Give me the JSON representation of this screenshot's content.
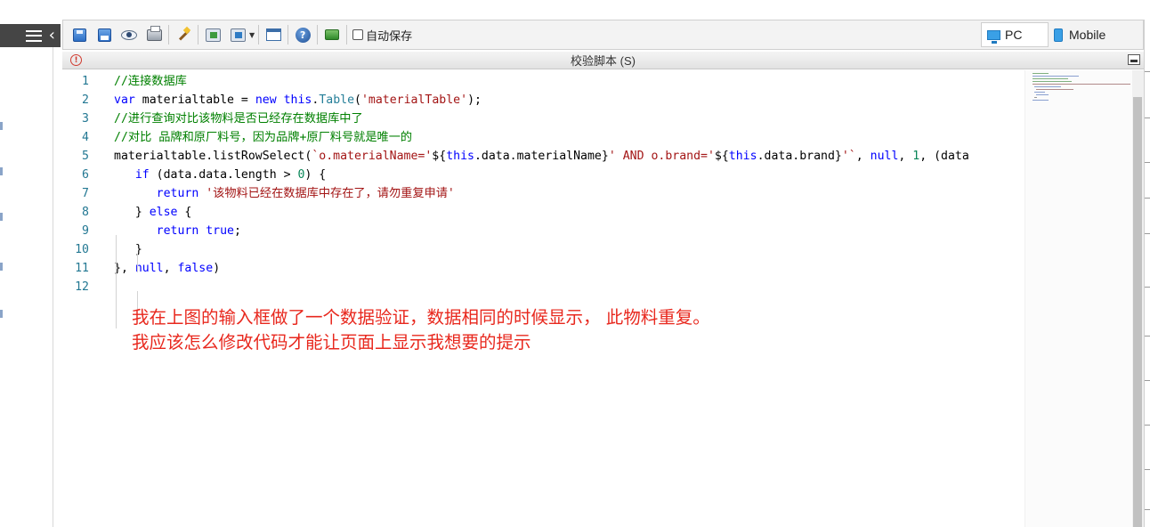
{
  "toolbar": {
    "icons": [
      "save-icon",
      "save-as-icon",
      "preview-icon",
      "print-icon",
      "magic-wand-icon",
      "import-icon",
      "export-icon",
      "window-icon",
      "help-icon",
      "green-block-icon"
    ],
    "autosave_label": "自动保存",
    "autosave_checked": false,
    "device_pc_label": "PC",
    "device_mobile_label": "Mobile"
  },
  "panel": {
    "title": "校验脚本 (S)"
  },
  "editor": {
    "lines": [
      {
        "n": "1",
        "html": "<span class=\"t-comment\">//连接数据库</span>"
      },
      {
        "n": "2",
        "html": "<span class=\"t-key\">var</span> materialtable = <span class=\"t-key\">new</span> <span class=\"t-key\">this</span>.<span class=\"t-type\">Table</span>(<span class=\"t-str\">'materialTable'</span>);"
      },
      {
        "n": "3",
        "html": "<span class=\"t-comment\">//进行查询对比该物料是否已经存在数据库中了</span>"
      },
      {
        "n": "4",
        "html": "<span class=\"t-comment\">//对比 品牌和原厂料号，因为品牌+原厂料号就是唯一的</span>"
      },
      {
        "n": "5",
        "html": "materialtable.listRowSelect(<span class=\"t-str\">`o.materialName='</span>${<span class=\"t-key\">this</span>.data.materialName}<span class=\"t-str\">' AND o.brand='</span>${<span class=\"t-key\">this</span>.data.brand}<span class=\"t-str\">'`</span>, <span class=\"t-key\">null</span>, <span class=\"t-num\">1</span>, (data"
      },
      {
        "n": "6",
        "html": "   <span class=\"t-key\">if</span> (data.data.length &gt; <span class=\"t-num\">0</span>) {"
      },
      {
        "n": "7",
        "html": "      <span class=\"t-key\">return</span> <span class=\"t-str\">'该物料已经在数据库中存在了，请勿重复申请'</span>"
      },
      {
        "n": "8",
        "html": "   } <span class=\"t-key\">else</span> {"
      },
      {
        "n": "9",
        "html": "      <span class=\"t-key\">return</span> <span class=\"t-key\">true</span>;"
      },
      {
        "n": "10",
        "html": "   }"
      },
      {
        "n": "11",
        "html": "}, <span class=\"t-key\">null</span>, <span class=\"t-key\">false</span>)"
      },
      {
        "n": "12",
        "html": ""
      }
    ]
  },
  "annotation": {
    "line1": "我在上图的输入框做了一个数据验证，数据相同的时候显示， 此物料重复。",
    "line2": "我应该怎么修改代码才能让页面上显示我想要的提示"
  },
  "colors": {
    "annotation": "#e8281e",
    "comment": "#008000",
    "keyword": "#0000ff",
    "string": "#a31515",
    "line_number": "#237893"
  }
}
